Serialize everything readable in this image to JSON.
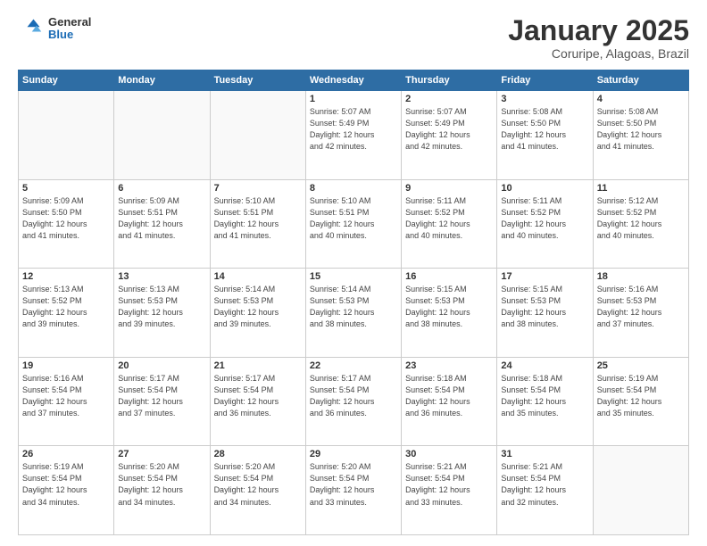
{
  "header": {
    "logo_general": "General",
    "logo_blue": "Blue",
    "month_title": "January 2025",
    "location": "Coruripe, Alagoas, Brazil"
  },
  "weekdays": [
    "Sunday",
    "Monday",
    "Tuesday",
    "Wednesday",
    "Thursday",
    "Friday",
    "Saturday"
  ],
  "weeks": [
    [
      {
        "day": "",
        "empty": true
      },
      {
        "day": "",
        "empty": true
      },
      {
        "day": "",
        "empty": true
      },
      {
        "day": "1",
        "lines": [
          "Sunrise: 5:07 AM",
          "Sunset: 5:49 PM",
          "Daylight: 12 hours",
          "and 42 minutes."
        ]
      },
      {
        "day": "2",
        "lines": [
          "Sunrise: 5:07 AM",
          "Sunset: 5:49 PM",
          "Daylight: 12 hours",
          "and 42 minutes."
        ]
      },
      {
        "day": "3",
        "lines": [
          "Sunrise: 5:08 AM",
          "Sunset: 5:50 PM",
          "Daylight: 12 hours",
          "and 41 minutes."
        ]
      },
      {
        "day": "4",
        "lines": [
          "Sunrise: 5:08 AM",
          "Sunset: 5:50 PM",
          "Daylight: 12 hours",
          "and 41 minutes."
        ]
      }
    ],
    [
      {
        "day": "5",
        "lines": [
          "Sunrise: 5:09 AM",
          "Sunset: 5:50 PM",
          "Daylight: 12 hours",
          "and 41 minutes."
        ]
      },
      {
        "day": "6",
        "lines": [
          "Sunrise: 5:09 AM",
          "Sunset: 5:51 PM",
          "Daylight: 12 hours",
          "and 41 minutes."
        ]
      },
      {
        "day": "7",
        "lines": [
          "Sunrise: 5:10 AM",
          "Sunset: 5:51 PM",
          "Daylight: 12 hours",
          "and 41 minutes."
        ]
      },
      {
        "day": "8",
        "lines": [
          "Sunrise: 5:10 AM",
          "Sunset: 5:51 PM",
          "Daylight: 12 hours",
          "and 40 minutes."
        ]
      },
      {
        "day": "9",
        "lines": [
          "Sunrise: 5:11 AM",
          "Sunset: 5:52 PM",
          "Daylight: 12 hours",
          "and 40 minutes."
        ]
      },
      {
        "day": "10",
        "lines": [
          "Sunrise: 5:11 AM",
          "Sunset: 5:52 PM",
          "Daylight: 12 hours",
          "and 40 minutes."
        ]
      },
      {
        "day": "11",
        "lines": [
          "Sunrise: 5:12 AM",
          "Sunset: 5:52 PM",
          "Daylight: 12 hours",
          "and 40 minutes."
        ]
      }
    ],
    [
      {
        "day": "12",
        "lines": [
          "Sunrise: 5:13 AM",
          "Sunset: 5:52 PM",
          "Daylight: 12 hours",
          "and 39 minutes."
        ]
      },
      {
        "day": "13",
        "lines": [
          "Sunrise: 5:13 AM",
          "Sunset: 5:53 PM",
          "Daylight: 12 hours",
          "and 39 minutes."
        ]
      },
      {
        "day": "14",
        "lines": [
          "Sunrise: 5:14 AM",
          "Sunset: 5:53 PM",
          "Daylight: 12 hours",
          "and 39 minutes."
        ]
      },
      {
        "day": "15",
        "lines": [
          "Sunrise: 5:14 AM",
          "Sunset: 5:53 PM",
          "Daylight: 12 hours",
          "and 38 minutes."
        ]
      },
      {
        "day": "16",
        "lines": [
          "Sunrise: 5:15 AM",
          "Sunset: 5:53 PM",
          "Daylight: 12 hours",
          "and 38 minutes."
        ]
      },
      {
        "day": "17",
        "lines": [
          "Sunrise: 5:15 AM",
          "Sunset: 5:53 PM",
          "Daylight: 12 hours",
          "and 38 minutes."
        ]
      },
      {
        "day": "18",
        "lines": [
          "Sunrise: 5:16 AM",
          "Sunset: 5:53 PM",
          "Daylight: 12 hours",
          "and 37 minutes."
        ]
      }
    ],
    [
      {
        "day": "19",
        "lines": [
          "Sunrise: 5:16 AM",
          "Sunset: 5:54 PM",
          "Daylight: 12 hours",
          "and 37 minutes."
        ]
      },
      {
        "day": "20",
        "lines": [
          "Sunrise: 5:17 AM",
          "Sunset: 5:54 PM",
          "Daylight: 12 hours",
          "and 37 minutes."
        ]
      },
      {
        "day": "21",
        "lines": [
          "Sunrise: 5:17 AM",
          "Sunset: 5:54 PM",
          "Daylight: 12 hours",
          "and 36 minutes."
        ]
      },
      {
        "day": "22",
        "lines": [
          "Sunrise: 5:17 AM",
          "Sunset: 5:54 PM",
          "Daylight: 12 hours",
          "and 36 minutes."
        ]
      },
      {
        "day": "23",
        "lines": [
          "Sunrise: 5:18 AM",
          "Sunset: 5:54 PM",
          "Daylight: 12 hours",
          "and 36 minutes."
        ]
      },
      {
        "day": "24",
        "lines": [
          "Sunrise: 5:18 AM",
          "Sunset: 5:54 PM",
          "Daylight: 12 hours",
          "and 35 minutes."
        ]
      },
      {
        "day": "25",
        "lines": [
          "Sunrise: 5:19 AM",
          "Sunset: 5:54 PM",
          "Daylight: 12 hours",
          "and 35 minutes."
        ]
      }
    ],
    [
      {
        "day": "26",
        "lines": [
          "Sunrise: 5:19 AM",
          "Sunset: 5:54 PM",
          "Daylight: 12 hours",
          "and 34 minutes."
        ]
      },
      {
        "day": "27",
        "lines": [
          "Sunrise: 5:20 AM",
          "Sunset: 5:54 PM",
          "Daylight: 12 hours",
          "and 34 minutes."
        ]
      },
      {
        "day": "28",
        "lines": [
          "Sunrise: 5:20 AM",
          "Sunset: 5:54 PM",
          "Daylight: 12 hours",
          "and 34 minutes."
        ]
      },
      {
        "day": "29",
        "lines": [
          "Sunrise: 5:20 AM",
          "Sunset: 5:54 PM",
          "Daylight: 12 hours",
          "and 33 minutes."
        ]
      },
      {
        "day": "30",
        "lines": [
          "Sunrise: 5:21 AM",
          "Sunset: 5:54 PM",
          "Daylight: 12 hours",
          "and 33 minutes."
        ]
      },
      {
        "day": "31",
        "lines": [
          "Sunrise: 5:21 AM",
          "Sunset: 5:54 PM",
          "Daylight: 12 hours",
          "and 32 minutes."
        ]
      },
      {
        "day": "",
        "empty": true
      }
    ]
  ]
}
